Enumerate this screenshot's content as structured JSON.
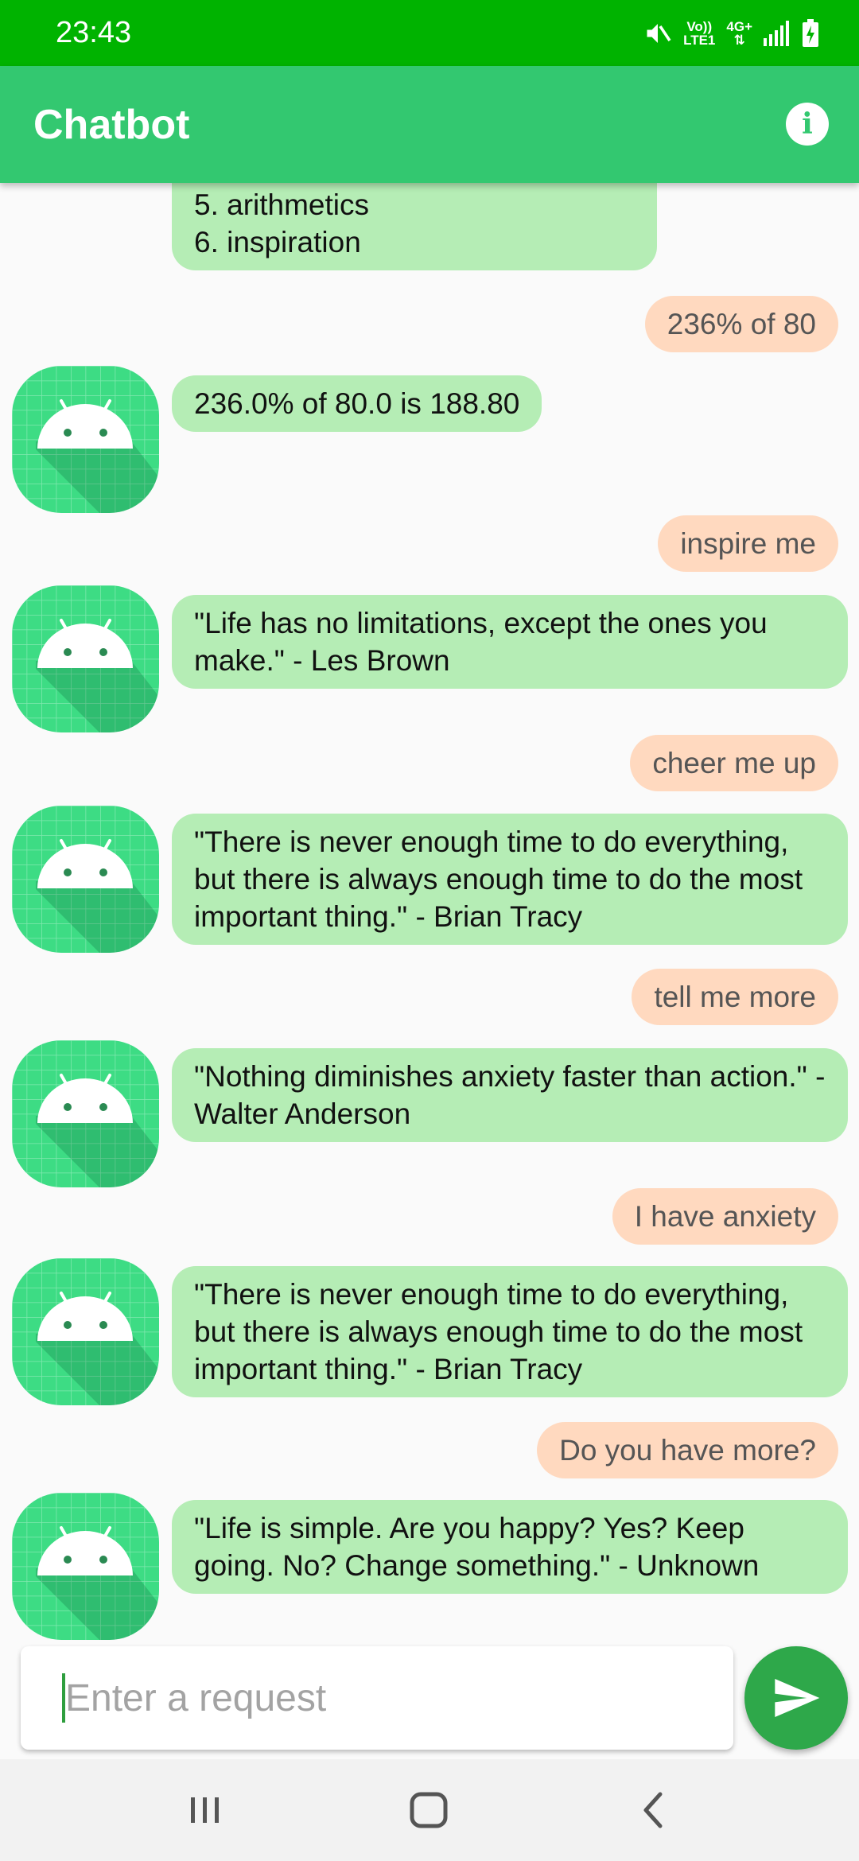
{
  "status_bar": {
    "time": "23:43",
    "network_line1": "Vo))",
    "network_line2": "LTE1",
    "network_type": "4G+",
    "icons": [
      "mute-icon",
      "signal-icon",
      "battery-charging-icon"
    ]
  },
  "app_bar": {
    "title": "Chatbot",
    "info_icon": "info-icon"
  },
  "messages": [
    {
      "sender": "bot",
      "text": "5. arithmetics\n6. inspiration"
    },
    {
      "sender": "user",
      "text": "236% of 80"
    },
    {
      "sender": "bot",
      "text": "236.0% of 80.0 is 188.80"
    },
    {
      "sender": "user",
      "text": "inspire me"
    },
    {
      "sender": "bot",
      "text": "\"Life has no limitations, except the ones you make.\" - Les Brown"
    },
    {
      "sender": "user",
      "text": "cheer me up"
    },
    {
      "sender": "bot",
      "text": "\"There is never enough time to do everything, but there is always enough time to do the most important thing.\" - Brian Tracy"
    },
    {
      "sender": "user",
      "text": "tell me more"
    },
    {
      "sender": "bot",
      "text": "\"Nothing diminishes anxiety faster than action.\" - Walter Anderson"
    },
    {
      "sender": "user",
      "text": "I have anxiety"
    },
    {
      "sender": "bot",
      "text": "\"There is never enough time to do everything, but there is always enough time to do the most important thing.\" - Brian Tracy"
    },
    {
      "sender": "user",
      "text": "Do you have more?"
    },
    {
      "sender": "bot",
      "text": "\"Life is simple. Are you happy? Yes? Keep going. No? Change something.\" - Unknown"
    }
  ],
  "input": {
    "placeholder": "Enter a request",
    "value": ""
  },
  "send_button": {
    "icon": "send-icon"
  },
  "nav_bar": {
    "buttons": [
      "recent-apps-icon",
      "home-icon",
      "back-icon"
    ]
  },
  "colors": {
    "status_bar": "#00b300",
    "app_bar": "#33c870",
    "bot_bubble": "#b5edb5",
    "user_bubble": "#ffd9bf",
    "send_button": "#2ea84a"
  }
}
